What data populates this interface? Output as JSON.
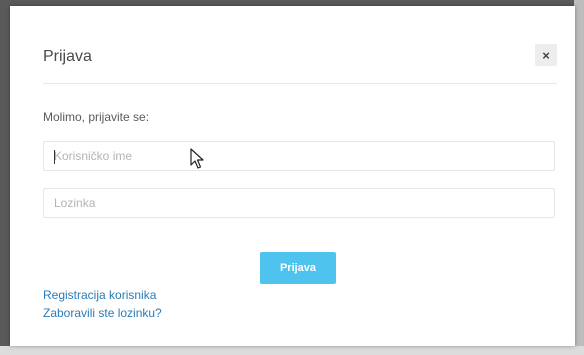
{
  "modal": {
    "title": "Prijava",
    "close_label": "×",
    "prompt": "Molimo, prijavite se:",
    "username_placeholder": "Korisničko ime",
    "password_placeholder": "Lozinka",
    "login_label": "Prijava",
    "register_link": "Registracija korisnika",
    "forgot_link": "Zaboravili ste lozinku?"
  },
  "colors": {
    "accent": "#4dc3ee",
    "link": "#2a7cb8"
  },
  "icons": {
    "close": "close-icon",
    "pointer": "mouse-pointer-icon"
  }
}
